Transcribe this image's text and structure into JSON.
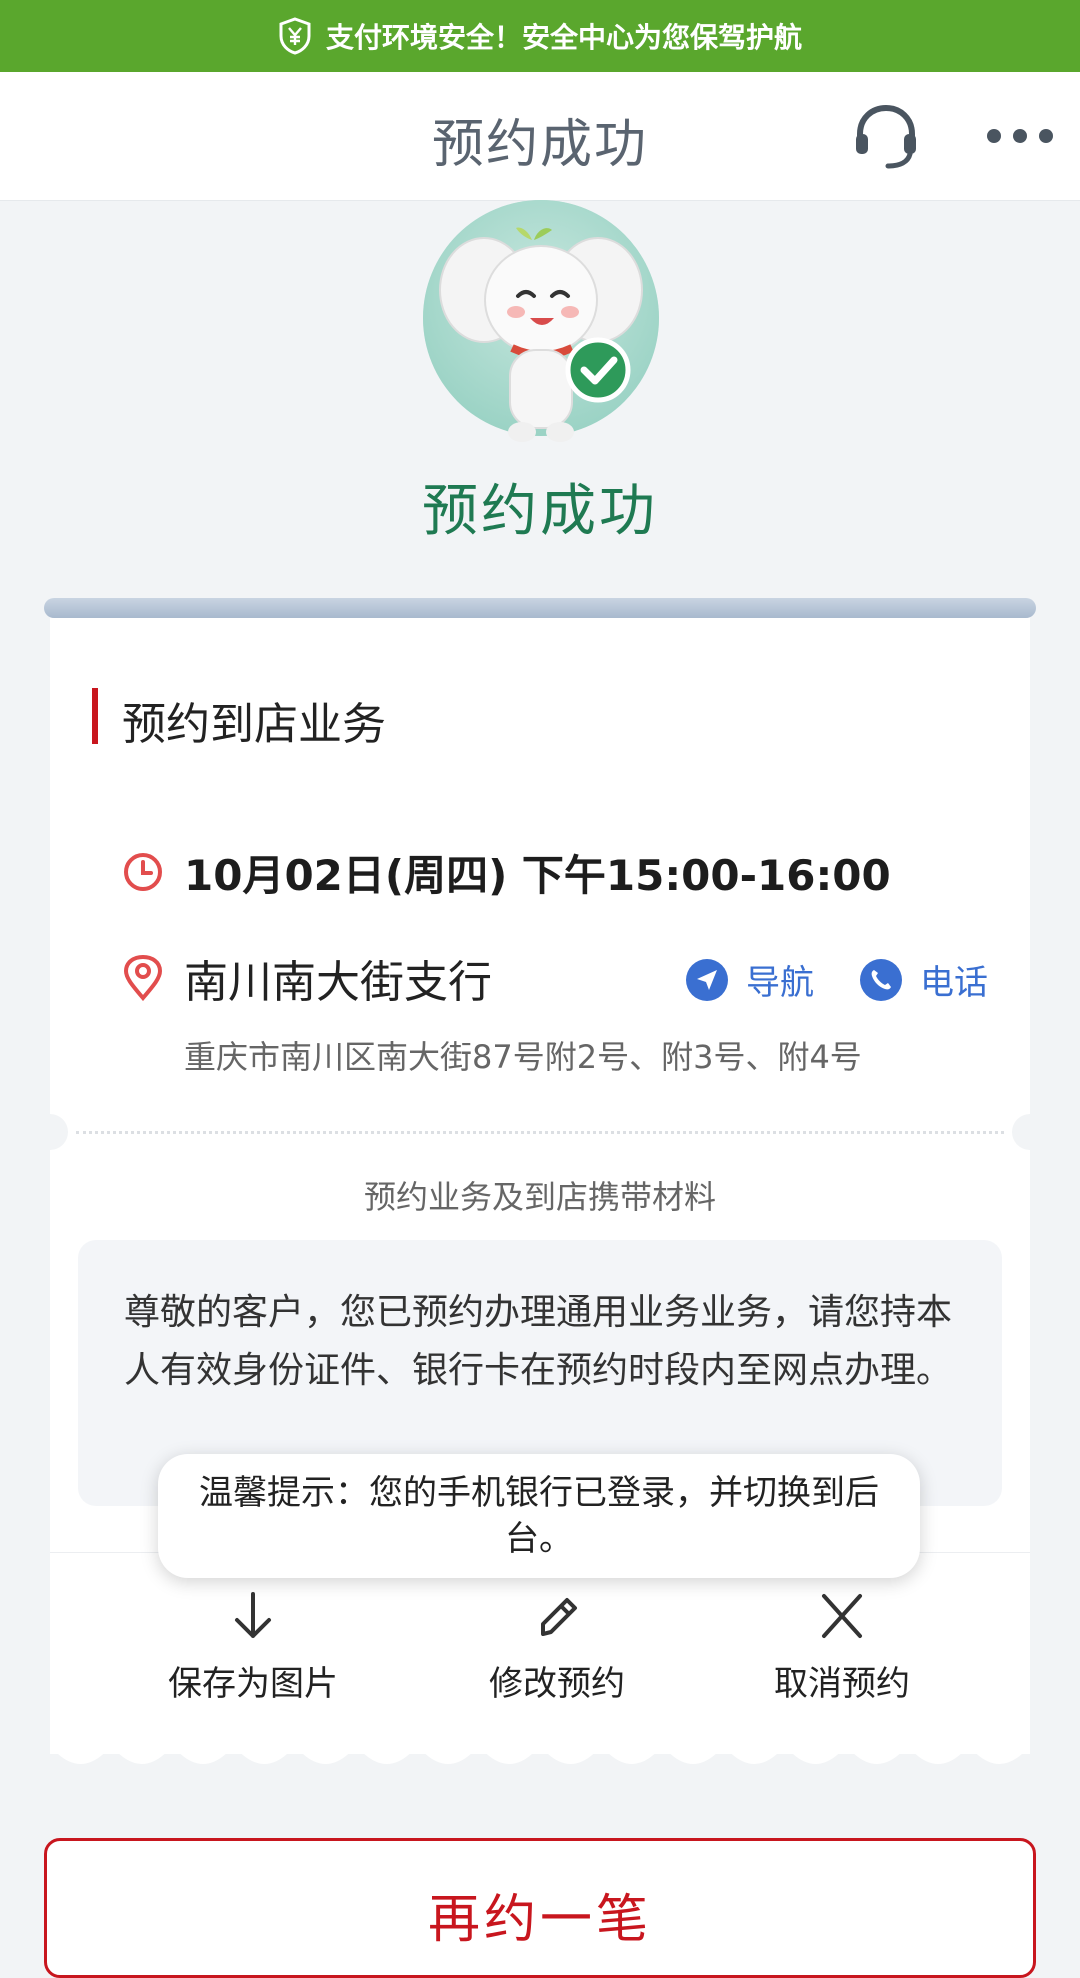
{
  "colors": {
    "banner_green": "#5aa72d",
    "success_green": "#1f7a52",
    "accent_red": "#c8161e",
    "link_blue": "#3a6fd1",
    "background": "#f2f4f6"
  },
  "security_banner": {
    "icon": "shield-yen-icon",
    "text": "支付环境安全！安全中心为您保驾护航"
  },
  "header": {
    "title": "预约成功",
    "support_icon": "headset-icon",
    "more_icon": "more-dots-icon"
  },
  "result": {
    "mascot": "elephant-mascot-check",
    "title": "预约成功"
  },
  "card": {
    "section_title": "预约到店业务",
    "time": {
      "icon": "clock-icon",
      "text": "10月02日(周四) 下午15:00-16:00"
    },
    "branch": {
      "icon": "location-pin-icon",
      "name": "南川南大街支行",
      "address": "重庆市南川区南大街87号附2号、附3号、附4号",
      "nav_label": "导航",
      "call_label": "电话"
    },
    "materials_title": "预约业务及到店携带材料",
    "notice": "尊敬的客户，您已预约办理通用业务业务，请您持本人有效身份证件、银行卡在预约时段内至网点办理。",
    "actions": [
      {
        "label": "保存为图片",
        "icon": "download-arrow-icon"
      },
      {
        "label": "修改预约",
        "icon": "edit-pencil-icon"
      },
      {
        "label": "取消预约",
        "icon": "close-x-icon"
      }
    ]
  },
  "toast": {
    "text": "温馨提示：您的手机银行已登录，并切换到后台。"
  },
  "again_button": {
    "label": "再约一笔"
  }
}
